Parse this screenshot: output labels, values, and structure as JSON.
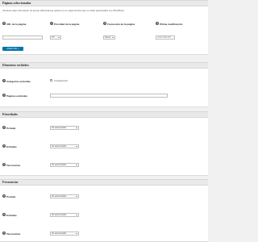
{
  "sections": {
    "selected_pages": {
      "title": "Páginas seleccionadas",
      "description": "Introduce aquí información de tiempo adicional que quieres en el mapa del sitio que no están gestionadas con WordPress",
      "fields": {
        "url": {
          "label": "URL de la página",
          "value": ""
        },
        "priority": {
          "label": "Prioridad de la página",
          "value": "0.5"
        },
        "frequency": {
          "label": "Frecuencia de la página",
          "value": "Nunca"
        },
        "last_modified": {
          "label": "Última modificación",
          "value": "AAAA-MM-DD"
        }
      },
      "add_button": "Añadir URL +"
    },
    "excluded_elements": {
      "title": "Elementos excluidos",
      "excluded_categories": {
        "label": "Categorías excluidas",
        "checkbox_label": "Uncategorized"
      },
      "excluded_pages": {
        "label": "Páginas excluidas",
        "value": ""
      }
    },
    "priorities": {
      "title": "Prioridades",
      "rows": [
        {
          "label": "Portada",
          "value": "No seleccionable"
        },
        {
          "label": "Entradas",
          "value": "No seleccionable"
        },
        {
          "label": "Taxonomías",
          "value": "No seleccionable"
        }
      ]
    },
    "frequencies": {
      "title": "Frecuencias",
      "rows": [
        {
          "label": "Portada",
          "value": "No seleccionable"
        },
        {
          "label": "Entradas",
          "value": "No seleccionable"
        },
        {
          "label": "Taxonomías",
          "value": "No seleccionable"
        }
      ]
    }
  },
  "icons": {
    "help": "question-circle-icon",
    "dropdown": "chevron-down-icon"
  },
  "colors": {
    "primary_button": "#0073aa",
    "header_bg": "#e9e9e9",
    "page_bg": "#f1f1f1"
  }
}
